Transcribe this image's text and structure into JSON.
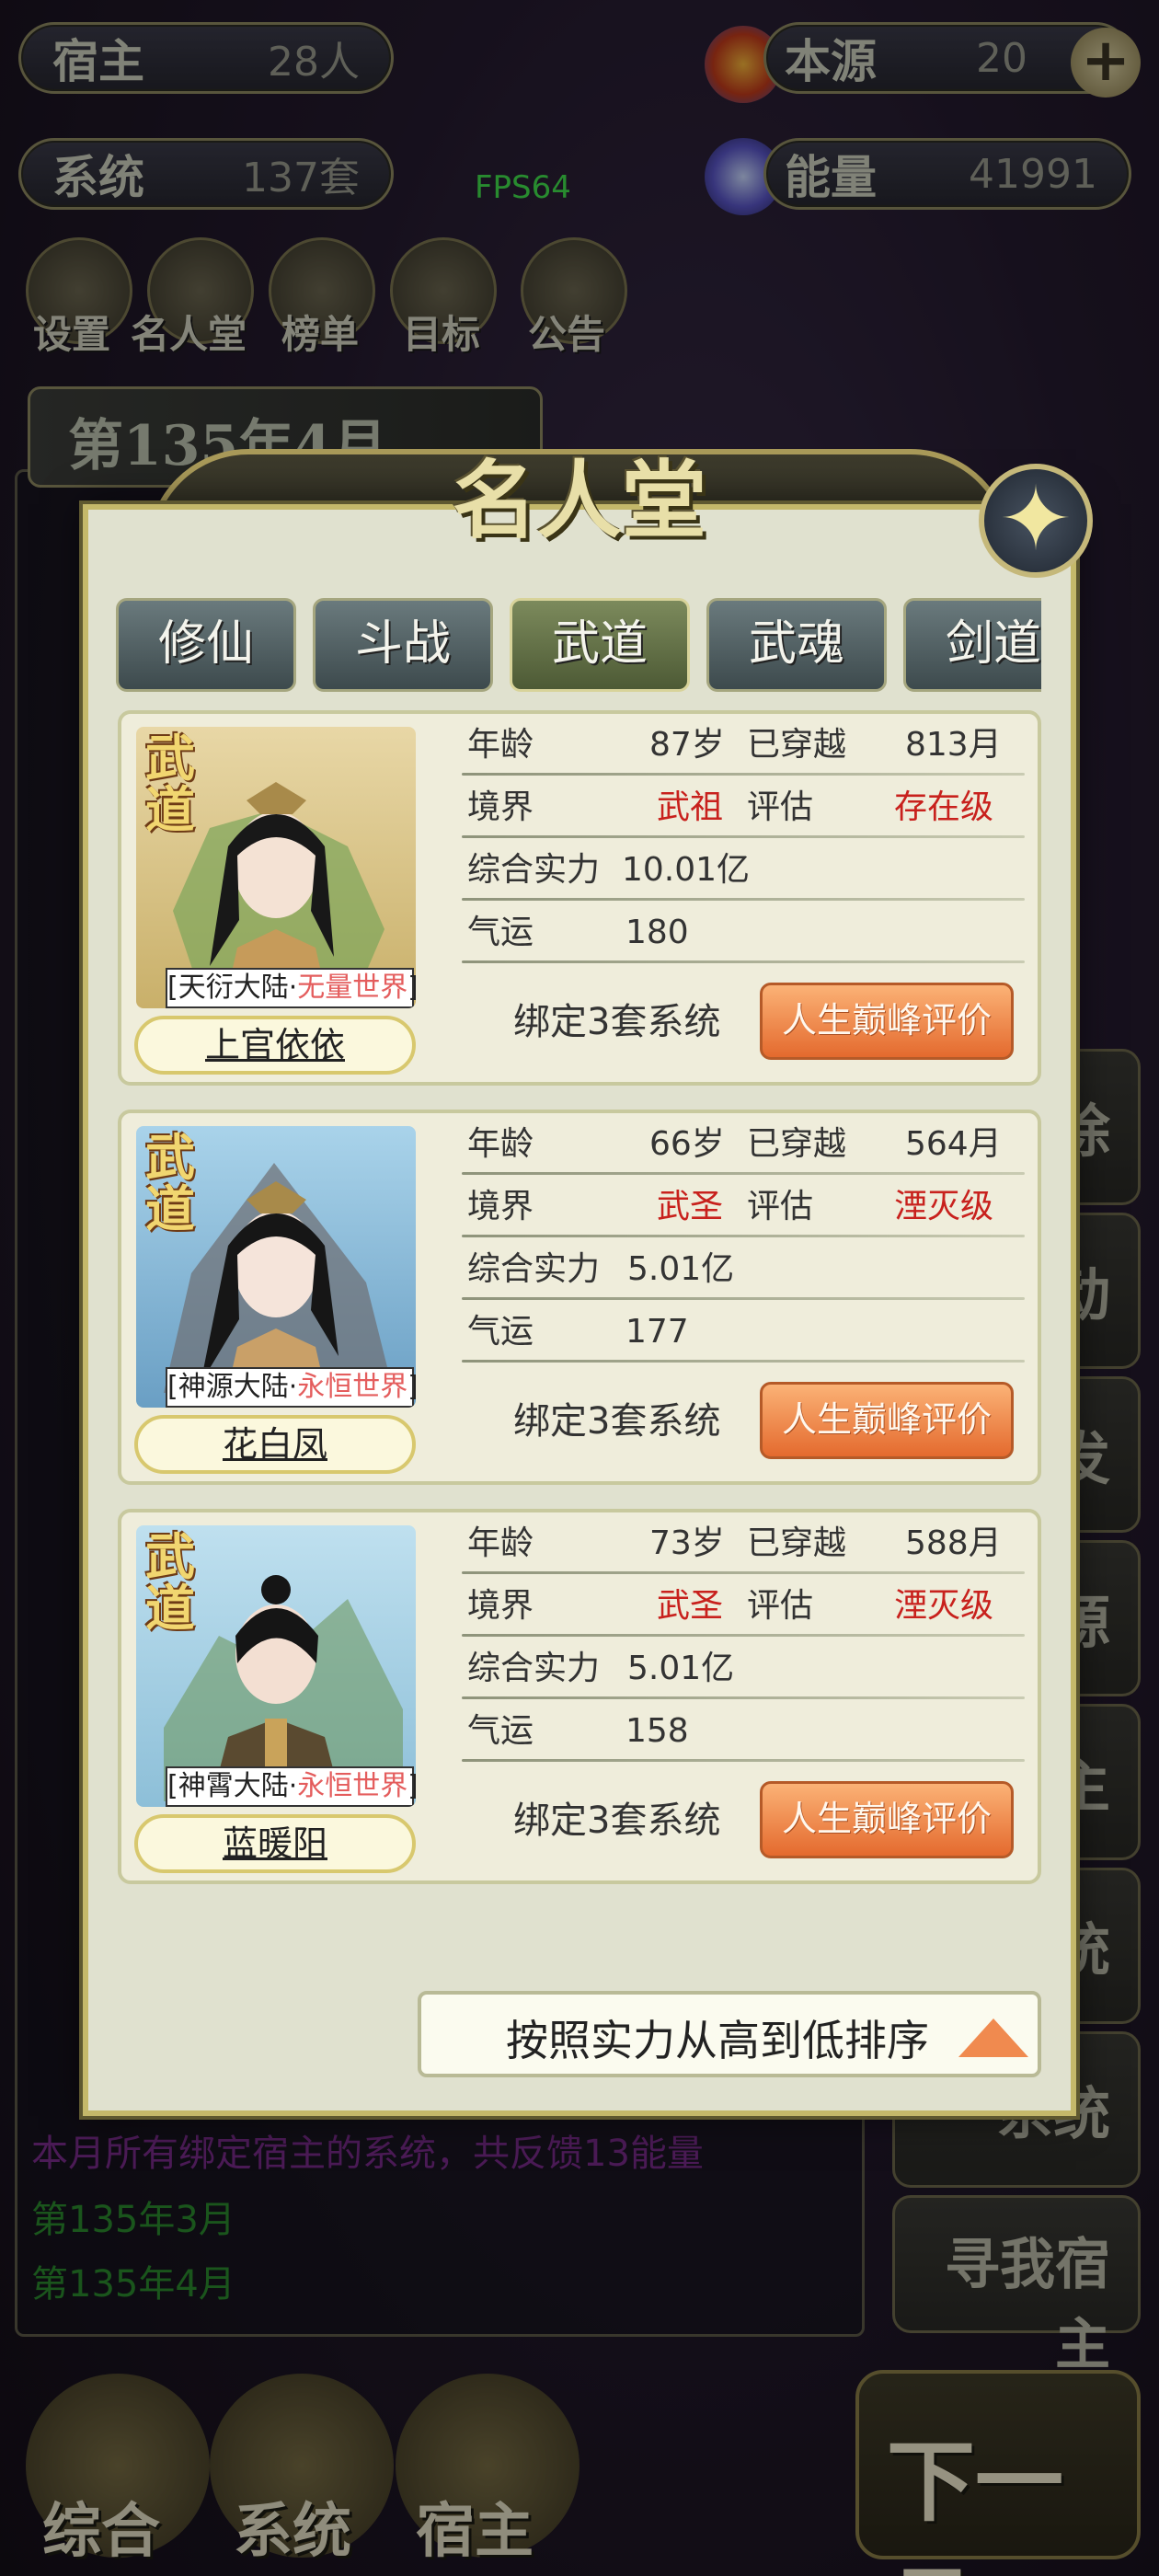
{
  "header": {
    "host_label": "宿主",
    "host_value": "28人",
    "system_label": "系统",
    "system_value": "137套",
    "source_label": "本源",
    "source_value": "20",
    "energy_label": "能量",
    "energy_value": "41991",
    "fps": "FPS64"
  },
  "topnav": [
    "设置",
    "名人堂",
    "榜单",
    "目标",
    "公告"
  ],
  "date": "第135年4月",
  "log_visible": [
    "本月所有绑定宿主的系统，共反馈13能量",
    "第135年3月",
    "第135年4月"
  ],
  "side_buttons": [
    "除",
    "动",
    "发",
    "源",
    "主",
    "统",
    "系统"
  ],
  "find_host": "寻我宿主",
  "bottom_nav": [
    "综合",
    "系统",
    "宿主"
  ],
  "next_month": "下一月",
  "dialog": {
    "title": "名人堂",
    "tabs": [
      "修仙",
      "斗战",
      "武道",
      "武魂",
      "剑道"
    ],
    "active_tab": "武道",
    "labels": {
      "age": "年龄",
      "travel": "已穿越",
      "realm": "境界",
      "assess": "评估",
      "power": "综合实力",
      "luck": "气运",
      "badge": "武道",
      "eval_button": "人生巅峰评价"
    },
    "entries": [
      {
        "name": "上官依依",
        "world_a": "天衍大陆·",
        "world_b": "无量世界",
        "age": "87岁",
        "travel": "813月",
        "realm": "武祖",
        "assess": "存在级",
        "power": "10.01亿",
        "luck": "180",
        "bind": "绑定3套系统"
      },
      {
        "name": "花白凤",
        "world_a": "神源大陆·",
        "world_b": "永恒世界",
        "age": "66岁",
        "travel": "564月",
        "realm": "武圣",
        "assess": "湮灭级",
        "power": "5.01亿",
        "luck": "177",
        "bind": "绑定3套系统"
      },
      {
        "name": "蓝暖阳",
        "world_a": "神霄大陆·",
        "world_b": "永恒世界",
        "age": "73岁",
        "travel": "588月",
        "realm": "武圣",
        "assess": "湮灭级",
        "power": "5.01亿",
        "luck": "158",
        "bind": "绑定3套系统"
      }
    ],
    "sort_label": "按照实力从高到低排序"
  },
  "colors": {
    "accent_red": "#c8211d",
    "button_orange": "#e46a2e",
    "dialog_bg": "#e0e1cf"
  }
}
